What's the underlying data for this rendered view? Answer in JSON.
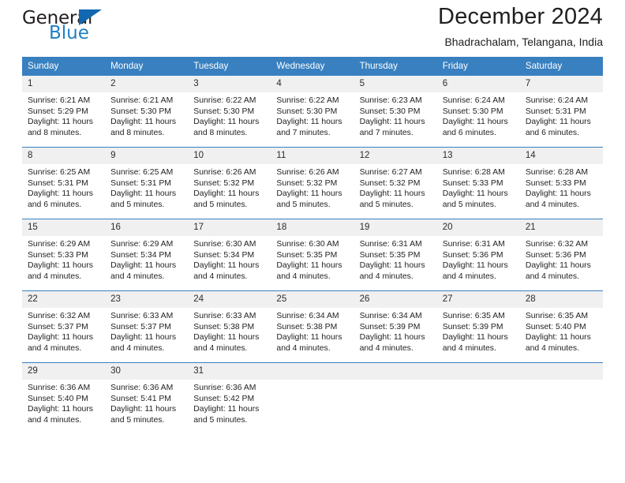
{
  "brand": {
    "line1": "General",
    "line2": "Blue",
    "triangle_color": "#1168b0",
    "blue_color": "#1f7fc4"
  },
  "header": {
    "title": "December 2024",
    "subtitle": "Bhadrachalam, Telangana, India"
  },
  "theme": {
    "header_bg": "#3880c0",
    "daynum_bg": "#f0f0f0",
    "text": "#222222"
  },
  "weekdays": [
    "Sunday",
    "Monday",
    "Tuesday",
    "Wednesday",
    "Thursday",
    "Friday",
    "Saturday"
  ],
  "weeks": [
    [
      {
        "day": "1",
        "sunrise": "Sunrise: 6:21 AM",
        "sunset": "Sunset: 5:29 PM",
        "daylight1": "Daylight: 11 hours",
        "daylight2": "and 8 minutes."
      },
      {
        "day": "2",
        "sunrise": "Sunrise: 6:21 AM",
        "sunset": "Sunset: 5:30 PM",
        "daylight1": "Daylight: 11 hours",
        "daylight2": "and 8 minutes."
      },
      {
        "day": "3",
        "sunrise": "Sunrise: 6:22 AM",
        "sunset": "Sunset: 5:30 PM",
        "daylight1": "Daylight: 11 hours",
        "daylight2": "and 8 minutes."
      },
      {
        "day": "4",
        "sunrise": "Sunrise: 6:22 AM",
        "sunset": "Sunset: 5:30 PM",
        "daylight1": "Daylight: 11 hours",
        "daylight2": "and 7 minutes."
      },
      {
        "day": "5",
        "sunrise": "Sunrise: 6:23 AM",
        "sunset": "Sunset: 5:30 PM",
        "daylight1": "Daylight: 11 hours",
        "daylight2": "and 7 minutes."
      },
      {
        "day": "6",
        "sunrise": "Sunrise: 6:24 AM",
        "sunset": "Sunset: 5:30 PM",
        "daylight1": "Daylight: 11 hours",
        "daylight2": "and 6 minutes."
      },
      {
        "day": "7",
        "sunrise": "Sunrise: 6:24 AM",
        "sunset": "Sunset: 5:31 PM",
        "daylight1": "Daylight: 11 hours",
        "daylight2": "and 6 minutes."
      }
    ],
    [
      {
        "day": "8",
        "sunrise": "Sunrise: 6:25 AM",
        "sunset": "Sunset: 5:31 PM",
        "daylight1": "Daylight: 11 hours",
        "daylight2": "and 6 minutes."
      },
      {
        "day": "9",
        "sunrise": "Sunrise: 6:25 AM",
        "sunset": "Sunset: 5:31 PM",
        "daylight1": "Daylight: 11 hours",
        "daylight2": "and 5 minutes."
      },
      {
        "day": "10",
        "sunrise": "Sunrise: 6:26 AM",
        "sunset": "Sunset: 5:32 PM",
        "daylight1": "Daylight: 11 hours",
        "daylight2": "and 5 minutes."
      },
      {
        "day": "11",
        "sunrise": "Sunrise: 6:26 AM",
        "sunset": "Sunset: 5:32 PM",
        "daylight1": "Daylight: 11 hours",
        "daylight2": "and 5 minutes."
      },
      {
        "day": "12",
        "sunrise": "Sunrise: 6:27 AM",
        "sunset": "Sunset: 5:32 PM",
        "daylight1": "Daylight: 11 hours",
        "daylight2": "and 5 minutes."
      },
      {
        "day": "13",
        "sunrise": "Sunrise: 6:28 AM",
        "sunset": "Sunset: 5:33 PM",
        "daylight1": "Daylight: 11 hours",
        "daylight2": "and 5 minutes."
      },
      {
        "day": "14",
        "sunrise": "Sunrise: 6:28 AM",
        "sunset": "Sunset: 5:33 PM",
        "daylight1": "Daylight: 11 hours",
        "daylight2": "and 4 minutes."
      }
    ],
    [
      {
        "day": "15",
        "sunrise": "Sunrise: 6:29 AM",
        "sunset": "Sunset: 5:33 PM",
        "daylight1": "Daylight: 11 hours",
        "daylight2": "and 4 minutes."
      },
      {
        "day": "16",
        "sunrise": "Sunrise: 6:29 AM",
        "sunset": "Sunset: 5:34 PM",
        "daylight1": "Daylight: 11 hours",
        "daylight2": "and 4 minutes."
      },
      {
        "day": "17",
        "sunrise": "Sunrise: 6:30 AM",
        "sunset": "Sunset: 5:34 PM",
        "daylight1": "Daylight: 11 hours",
        "daylight2": "and 4 minutes."
      },
      {
        "day": "18",
        "sunrise": "Sunrise: 6:30 AM",
        "sunset": "Sunset: 5:35 PM",
        "daylight1": "Daylight: 11 hours",
        "daylight2": "and 4 minutes."
      },
      {
        "day": "19",
        "sunrise": "Sunrise: 6:31 AM",
        "sunset": "Sunset: 5:35 PM",
        "daylight1": "Daylight: 11 hours",
        "daylight2": "and 4 minutes."
      },
      {
        "day": "20",
        "sunrise": "Sunrise: 6:31 AM",
        "sunset": "Sunset: 5:36 PM",
        "daylight1": "Daylight: 11 hours",
        "daylight2": "and 4 minutes."
      },
      {
        "day": "21",
        "sunrise": "Sunrise: 6:32 AM",
        "sunset": "Sunset: 5:36 PM",
        "daylight1": "Daylight: 11 hours",
        "daylight2": "and 4 minutes."
      }
    ],
    [
      {
        "day": "22",
        "sunrise": "Sunrise: 6:32 AM",
        "sunset": "Sunset: 5:37 PM",
        "daylight1": "Daylight: 11 hours",
        "daylight2": "and 4 minutes."
      },
      {
        "day": "23",
        "sunrise": "Sunrise: 6:33 AM",
        "sunset": "Sunset: 5:37 PM",
        "daylight1": "Daylight: 11 hours",
        "daylight2": "and 4 minutes."
      },
      {
        "day": "24",
        "sunrise": "Sunrise: 6:33 AM",
        "sunset": "Sunset: 5:38 PM",
        "daylight1": "Daylight: 11 hours",
        "daylight2": "and 4 minutes."
      },
      {
        "day": "25",
        "sunrise": "Sunrise: 6:34 AM",
        "sunset": "Sunset: 5:38 PM",
        "daylight1": "Daylight: 11 hours",
        "daylight2": "and 4 minutes."
      },
      {
        "day": "26",
        "sunrise": "Sunrise: 6:34 AM",
        "sunset": "Sunset: 5:39 PM",
        "daylight1": "Daylight: 11 hours",
        "daylight2": "and 4 minutes."
      },
      {
        "day": "27",
        "sunrise": "Sunrise: 6:35 AM",
        "sunset": "Sunset: 5:39 PM",
        "daylight1": "Daylight: 11 hours",
        "daylight2": "and 4 minutes."
      },
      {
        "day": "28",
        "sunrise": "Sunrise: 6:35 AM",
        "sunset": "Sunset: 5:40 PM",
        "daylight1": "Daylight: 11 hours",
        "daylight2": "and 4 minutes."
      }
    ],
    [
      {
        "day": "29",
        "sunrise": "Sunrise: 6:36 AM",
        "sunset": "Sunset: 5:40 PM",
        "daylight1": "Daylight: 11 hours",
        "daylight2": "and 4 minutes."
      },
      {
        "day": "30",
        "sunrise": "Sunrise: 6:36 AM",
        "sunset": "Sunset: 5:41 PM",
        "daylight1": "Daylight: 11 hours",
        "daylight2": "and 5 minutes."
      },
      {
        "day": "31",
        "sunrise": "Sunrise: 6:36 AM",
        "sunset": "Sunset: 5:42 PM",
        "daylight1": "Daylight: 11 hours",
        "daylight2": "and 5 minutes."
      },
      {
        "day": "",
        "sunrise": "",
        "sunset": "",
        "daylight1": "",
        "daylight2": "",
        "empty": true
      },
      {
        "day": "",
        "sunrise": "",
        "sunset": "",
        "daylight1": "",
        "daylight2": "",
        "empty": true
      },
      {
        "day": "",
        "sunrise": "",
        "sunset": "",
        "daylight1": "",
        "daylight2": "",
        "empty": true
      },
      {
        "day": "",
        "sunrise": "",
        "sunset": "",
        "daylight1": "",
        "daylight2": "",
        "empty": true
      }
    ]
  ]
}
